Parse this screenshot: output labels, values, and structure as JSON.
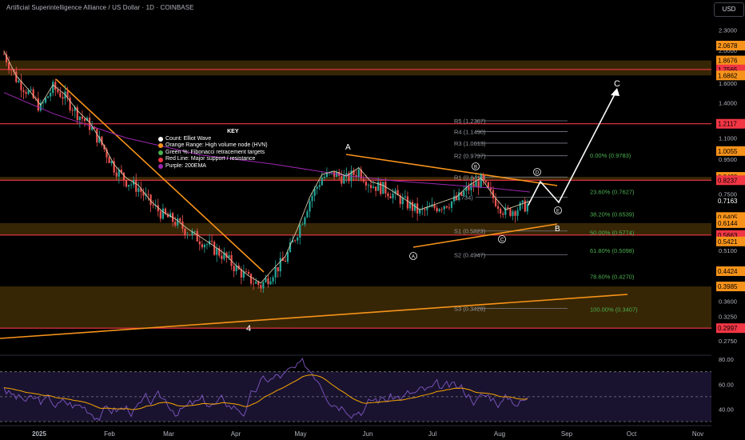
{
  "header": {
    "title": "Artificial Superintelligence Alliance / US Dollar · 1D · COINBASE"
  },
  "currency_button": {
    "label": "USD"
  },
  "key": {
    "title": "KEY",
    "items": [
      {
        "label": "Count: Elliot Wave",
        "color": "#ffffff"
      },
      {
        "label": "Orange Range: High volume node (HVN)",
        "color": "#f7931a"
      },
      {
        "label": "Green %: Fibonacci retracement targets",
        "color": "#4caf50"
      },
      {
        "label": "Red Line: Major support / resistance",
        "color": "#f23645"
      },
      {
        "label": "Purple: 200EMA",
        "color": "#9c27b0"
      }
    ]
  },
  "chart_data": [
    {
      "type": "candlestick",
      "title": "Artificial Superintelligence Alliance / US Dollar · 1D · COINBASE",
      "yscale": "log",
      "ylim": [
        0.28,
        3.0
      ],
      "y_tick_labels": [
        "2.3000",
        "2.0000",
        "1.6000",
        "1.4000",
        "1.1000",
        "0.9500",
        "0.7500",
        "0.5100",
        "0.4500",
        "0.3600",
        "0.3250",
        "0.2750"
      ],
      "x_tick_labels": [
        "2025",
        "Feb",
        "Mar",
        "Apr",
        "May",
        "Jun",
        "Jul",
        "Aug",
        "Sep",
        "Oct",
        "Nov"
      ],
      "price_tags": [
        {
          "value": "2.0678",
          "type": "hvn"
        },
        {
          "value": "1.8676",
          "type": "hvn"
        },
        {
          "value": "1.7565",
          "type": "red"
        },
        {
          "value": "1.6862",
          "type": "hvn"
        },
        {
          "value": "1.2117",
          "type": "red"
        },
        {
          "value": "1.0055",
          "type": "hvn"
        },
        {
          "value": "0.8429",
          "type": "hvn"
        },
        {
          "value": "0.8237",
          "type": "red"
        },
        {
          "value": "0.7163",
          "type": "current"
        },
        {
          "value": "0.6405",
          "type": "hvn"
        },
        {
          "value": "0.6144",
          "type": "hvn"
        },
        {
          "value": "0.5663",
          "type": "red"
        },
        {
          "value": "0.5421",
          "type": "hvn"
        },
        {
          "value": "0.4424",
          "type": "hvn"
        },
        {
          "value": "0.3985",
          "type": "hvn"
        },
        {
          "value": "0.2997",
          "type": "red"
        }
      ],
      "hvn_zones": [
        [
          1.6862,
          1.8676
        ],
        [
          0.8237,
          0.8429
        ],
        [
          0.5663,
          0.6144
        ],
        [
          0.2997,
          0.3985
        ]
      ],
      "red_lines": [
        1.7565,
        1.2117,
        0.8237,
        0.5663,
        0.2997
      ],
      "pivots": [
        {
          "label": "R5 (1.2367)",
          "value": 1.2367
        },
        {
          "label": "R4 (1.1490)",
          "value": 1.149
        },
        {
          "label": "R3 (1.0613)",
          "value": 1.0613
        },
        {
          "label": "R2 (0.9737)",
          "value": 0.9737
        },
        {
          "label": "R1 (0.8418)",
          "value": 0.8418
        },
        {
          "label": "(0.734)",
          "value": 0.734
        },
        {
          "label": "S1 (0.5823)",
          "value": 0.5823
        },
        {
          "label": "S2 (0.4947)",
          "value": 0.4947
        },
        {
          "label": "S3 (0.3428)",
          "value": 0.3428
        }
      ],
      "fib_levels": [
        {
          "label": "0.00% (0.9783)",
          "value": 0.9783
        },
        {
          "label": "23.60% (0.7627)",
          "value": 0.7627
        },
        {
          "label": "38.20% (0.6539)",
          "value": 0.6539
        },
        {
          "label": "50.00% (0.5774)",
          "value": 0.5774
        },
        {
          "label": "61.80% (0.5098)",
          "value": 0.5098
        },
        {
          "label": "78.60% (0.4270)",
          "value": 0.427
        },
        {
          "label": "100.00% (0.3407)",
          "value": 0.3407
        }
      ],
      "wave_labels": [
        "4",
        "A",
        "B",
        "C",
        "Ⓐ",
        "Ⓑ",
        "Ⓒ",
        "Ⓓ",
        "Ⓔ"
      ],
      "candles_approx": [
        [
          0,
          1.95
        ],
        [
          5,
          1.65
        ],
        [
          10,
          1.5
        ],
        [
          15,
          1.35
        ],
        [
          20,
          1.55
        ],
        [
          25,
          1.45
        ],
        [
          30,
          1.3
        ],
        [
          35,
          1.2
        ],
        [
          40,
          1.05
        ],
        [
          45,
          0.9
        ],
        [
          50,
          0.82
        ],
        [
          55,
          0.78
        ],
        [
          60,
          0.7
        ],
        [
          65,
          0.65
        ],
        [
          70,
          0.62
        ],
        [
          75,
          0.58
        ],
        [
          80,
          0.55
        ],
        [
          85,
          0.52
        ],
        [
          90,
          0.49
        ],
        [
          95,
          0.45
        ],
        [
          100,
          0.42
        ],
        [
          105,
          0.4
        ],
        [
          110,
          0.44
        ],
        [
          115,
          0.48
        ],
        [
          120,
          0.58
        ],
        [
          125,
          0.72
        ],
        [
          130,
          0.84
        ],
        [
          135,
          0.86
        ],
        [
          140,
          0.83
        ],
        [
          145,
          0.88
        ],
        [
          150,
          0.8
        ],
        [
          155,
          0.78
        ],
        [
          160,
          0.74
        ],
        [
          165,
          0.7
        ],
        [
          170,
          0.66
        ],
        [
          175,
          0.68
        ],
        [
          180,
          0.7
        ],
        [
          185,
          0.72
        ],
        [
          190,
          0.78
        ],
        [
          195,
          0.82
        ],
        [
          200,
          0.73
        ],
        [
          205,
          0.66
        ],
        [
          210,
          0.68
        ],
        [
          215,
          0.7
        ]
      ]
    },
    {
      "type": "line",
      "title": "RSI",
      "ylim": [
        30,
        82
      ],
      "y_tick_labels": [
        "80.00",
        "60.00",
        "40.00"
      ],
      "levels": [
        70,
        50,
        30
      ]
    }
  ]
}
